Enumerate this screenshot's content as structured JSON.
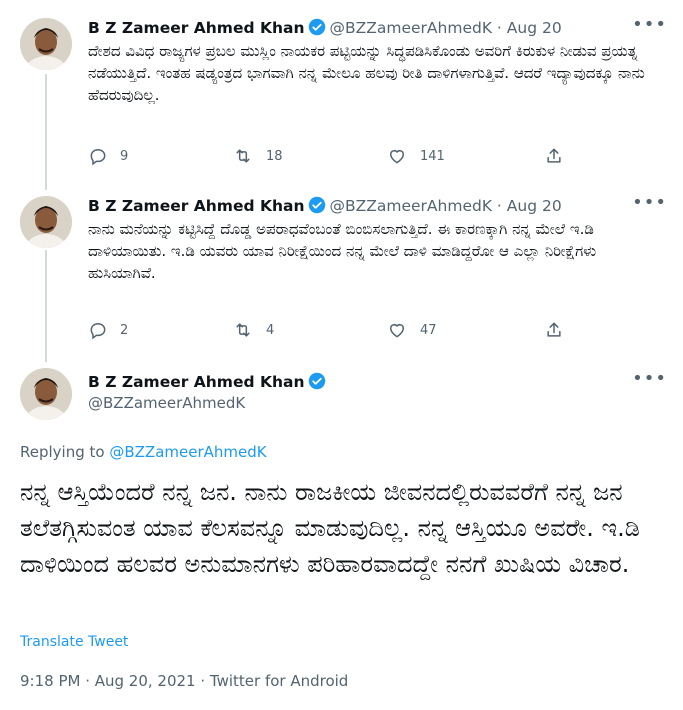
{
  "author": {
    "name": "B Z Zameer Ahmed Khan",
    "handle": "@BZZameerAhmedK"
  },
  "tweets": [
    {
      "date": "Aug 20",
      "separator": "·",
      "text": "ದೇಶದ ವಿವಿಧ ರಾಜ್ಯಗಳ ಪ್ರಬಲ ಮುಸ್ಲಿಂ ನಾಯಕರ ಪಟ್ಟಿಯನ್ನು ಸಿದ್ಧಪಡಿಸಿಕೊಂಡು ಅವರಿಗೆ ಕಿರುಕುಳ ನೀಡುವ ಪ್ರಯತ್ನ ನಡೆಯುತ್ತಿದೆ. ಇಂತಹ ಷಡ್ಯಂತ್ರದ ಭಾಗವಾಗಿ ನನ್ನ ಮೇಲೂ ಹಲವು ರೀತಿ ದಾಳಿಗಳಾಗುತ್ತಿವೆ. ಆದರೆ ಇದ್ಯಾವುದಕ್ಕೂ ನಾನು ಹೆದರುವುದಿಲ್ಲ.",
      "replies": "9",
      "retweets": "18",
      "likes": "141"
    },
    {
      "date": "Aug 20",
      "separator": "·",
      "text": "ನಾನು ಮನೆಯನ್ನು ಕಟ್ಟಿಸಿದ್ದೆ ದೊಡ್ಡ ಅಪರಾಧವೆಂಬಂತೆ ಬಿಂಬಿಸಲಾಗುತ್ತಿದೆ. ಈ ಕಾರಣಕ್ಕಾಗಿ ನನ್ನ ಮೇಲೆ ಇ.ಡಿ ದಾಳಿಯಾಯಿತು. ಇ.ಡಿ ಯವರು ಯಾವ ನಿರೀಕ್ಷೆಯಿಂದ ನನ್ನ ಮೇಲೆ ದಾಳಿ ಮಾಡಿದ್ದರೋ ಆ ಎಲ್ಲಾ ನಿರೀಕ್ಷೆಗಳು ಹುಸಿಯಾಗಿವೆ.",
      "replies": "2",
      "retweets": "4",
      "likes": "47"
    }
  ],
  "main_tweet": {
    "replying_prefix": "Replying to",
    "replying_to": "@BZZameerAhmedK",
    "text": "ನನ್ನ ಆಸ್ತಿಯೆಂದರೆ ನನ್ನ ಜನ. ನಾನು ರಾಜಕೀಯ ಜೀವನದಲ್ಲಿರುವವರೆಗೆ ನನ್ನ ಜನ ತಲೆತಗ್ಗಿಸುವಂತ ಯಾವ ಕೆಲಸವನ್ನೂ ಮಾಡುವುದಿಲ್ಲ. ನನ್ನ ಆಸ್ತಿಯೂ ಅವರೇ. ಇ.ಡಿ ದಾಳಿಯಿಂದ ಹಲವರ ಅನುಮಾನಗಳು ಪರಿಹಾರವಾದದ್ದೇ ನನಗೆ ಖುಷಿಯ ವಿಚಾರ.",
    "translate_label": "Translate Tweet",
    "meta": "9:18 PM · Aug 20, 2021 · Twitter for Android"
  },
  "colors": {
    "accent": "#1d9bf0",
    "muted": "#536471",
    "text": "#0f1419"
  },
  "icons": [
    "verified-badge-icon",
    "more-icon",
    "reply-icon",
    "retweet-icon",
    "like-icon",
    "share-icon"
  ]
}
